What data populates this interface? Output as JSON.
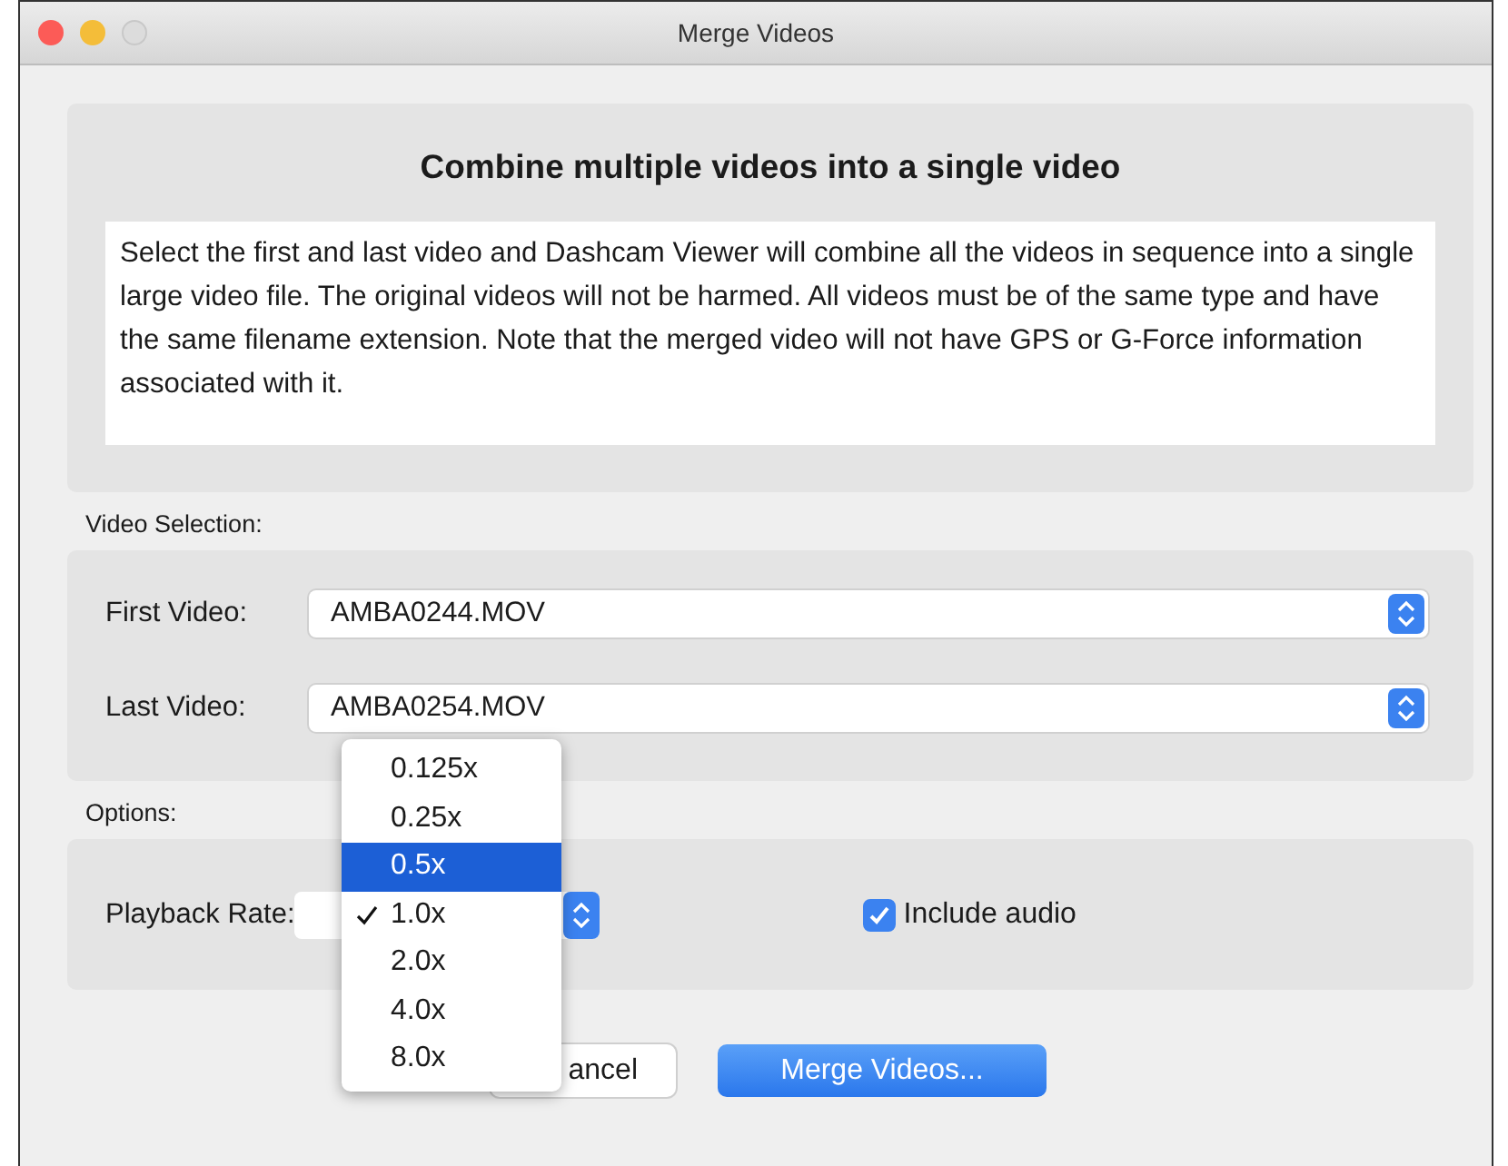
{
  "window": {
    "title": "Merge Videos"
  },
  "intro": {
    "heading": "Combine multiple videos into a single video",
    "description": "Select the first and last video and Dashcam Viewer will combine all the videos in sequence into a single large video file. The original videos will not be harmed. All videos must be of the same type and have the same filename extension. Note that the merged video will not have GPS or G-Force information associated with it."
  },
  "video_selection": {
    "label": "Video Selection:",
    "fields": [
      {
        "label": "First Video:",
        "value": "AMBA0244.MOV"
      },
      {
        "label": "Last Video:",
        "value": "AMBA0254.MOV"
      }
    ]
  },
  "options": {
    "label": "Options:",
    "playback_rate_label": "Playback Rate:",
    "include_audio": {
      "label": "Include audio",
      "checked": true
    }
  },
  "playback_menu": [
    {
      "label": "0.125x",
      "selected": false,
      "checked": false
    },
    {
      "label": "0.25x",
      "selected": false,
      "checked": false
    },
    {
      "label": "0.5x",
      "selected": true,
      "checked": false
    },
    {
      "label": "1.0x",
      "selected": false,
      "checked": true
    },
    {
      "label": "2.0x",
      "selected": false,
      "checked": false
    },
    {
      "label": "4.0x",
      "selected": false,
      "checked": false
    },
    {
      "label": "8.0x",
      "selected": false,
      "checked": false
    }
  ],
  "buttons": [
    {
      "label": "ancel",
      "kind": "secondary"
    },
    {
      "label": "Merge Videos...",
      "kind": "primary"
    }
  ]
}
